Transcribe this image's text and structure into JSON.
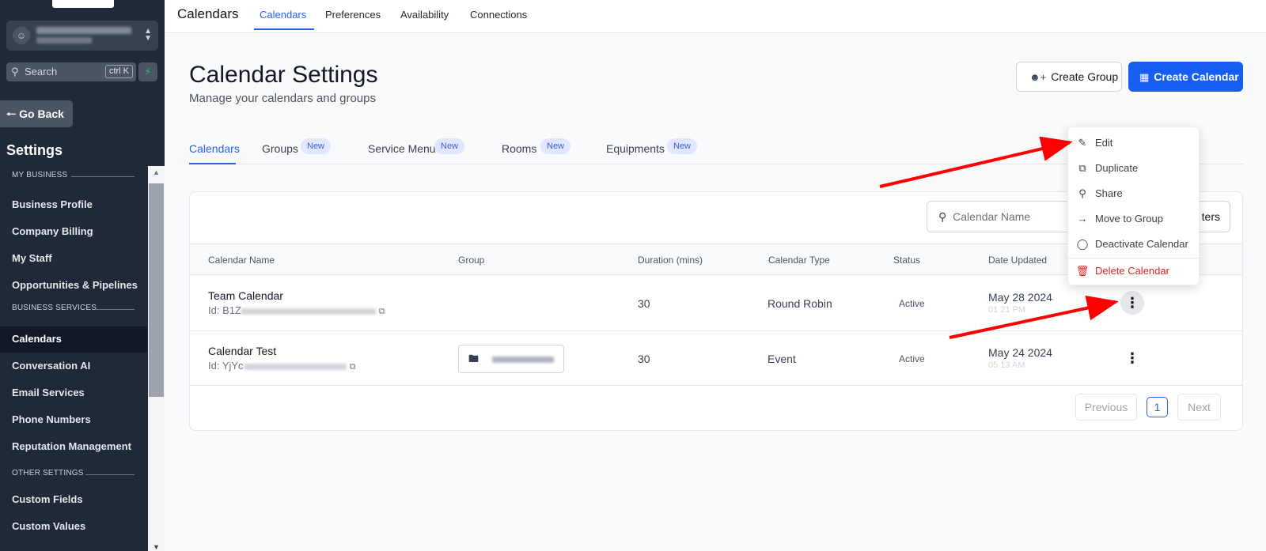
{
  "sidebar": {
    "search_placeholder": "Search",
    "search_shortcut": "ctrl K",
    "go_back": "Go Back",
    "settings_title": "Settings",
    "sections": {
      "my_business": "MY BUSINESS",
      "business_services": "BUSINESS SERVICES",
      "other_settings": "OTHER SETTINGS"
    },
    "items": [
      "Business Profile",
      "Company Billing",
      "My Staff",
      "Opportunities & Pipelines",
      "Calendars",
      "Conversation AI",
      "Email Services",
      "Phone Numbers",
      "Reputation Management",
      "Custom Fields",
      "Custom Values"
    ],
    "active_item": "Calendars"
  },
  "topnav": {
    "title": "Calendars",
    "tabs": [
      "Calendars",
      "Preferences",
      "Availability",
      "Connections"
    ],
    "active_tab": "Calendars"
  },
  "header": {
    "title": "Calendar Settings",
    "subtitle": "Manage your calendars and groups",
    "create_group": "Create Group",
    "create_calendar": "Create Calendar"
  },
  "subtabs": [
    {
      "label": "Calendars",
      "badge": ""
    },
    {
      "label": "Groups",
      "badge": "New"
    },
    {
      "label": "Service Menu",
      "badge": "New"
    },
    {
      "label": "Rooms",
      "badge": "New"
    },
    {
      "label": "Equipments",
      "badge": "New"
    }
  ],
  "toolbar": {
    "search_placeholder": "Calendar Name",
    "filters_label": "ters"
  },
  "table": {
    "columns": [
      "Calendar Name",
      "Group",
      "Duration (mins)",
      "Calendar Type",
      "Status",
      "Date Updated"
    ],
    "rows": [
      {
        "name": "Team Calendar",
        "id_prefix": "Id: B1Z",
        "duration": "30",
        "type": "Round Robin",
        "status": "Active",
        "date": "May 28 2024",
        "time": "01 21 PM"
      },
      {
        "name": "Calendar Test",
        "id_prefix": "Id: YjYc",
        "duration": "30",
        "type": "Event",
        "status": "Active",
        "date": "May 24 2024",
        "time": "05 13 AM"
      }
    ]
  },
  "pagination": {
    "previous": "Previous",
    "page": "1",
    "next": "Next"
  },
  "menu": {
    "items": [
      "Edit",
      "Duplicate",
      "Share",
      "Move to Group",
      "Deactivate Calendar",
      "Delete Calendar"
    ]
  },
  "colors": {
    "accent": "#155eef",
    "sidebar_bg": "#1f2937",
    "danger": "#dc2626",
    "annotation_arrow": "#ff0000"
  },
  "icons": [
    "user-icon",
    "updown-icon",
    "search-icon",
    "bolt-icon",
    "arrow-left-icon",
    "user-plus-icon",
    "calendar-icon",
    "copy-icon",
    "folder-icon",
    "kebab-icon",
    "pencil-icon",
    "duplicate-icon",
    "share-icon",
    "arrow-right-icon",
    "toggle-icon",
    "trash-icon"
  ]
}
